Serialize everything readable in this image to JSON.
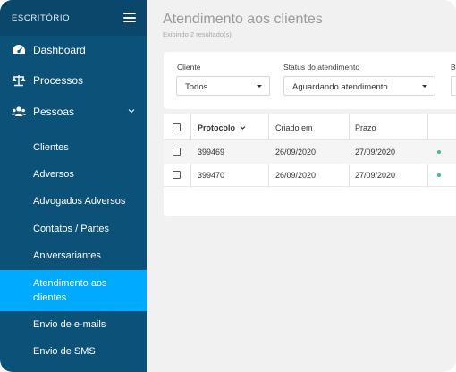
{
  "sidebar": {
    "brand": "ESCRITÓRIO",
    "menu_icon": "hamburger-menu-icon",
    "items": [
      {
        "label": "Dashboard",
        "icon": "speedometer-icon"
      },
      {
        "label": "Processos",
        "icon": "scales-icon"
      },
      {
        "label": "Pessoas",
        "icon": "users-icon",
        "expanded": true
      }
    ],
    "sub_items": [
      {
        "label": "Clientes"
      },
      {
        "label": "Adversos"
      },
      {
        "label": "Advogados Adversos"
      },
      {
        "label": "Contatos / Partes"
      },
      {
        "label": "Aniversariantes"
      },
      {
        "label_line1": "Atendimento aos",
        "label_line2": "clientes",
        "active": true
      },
      {
        "label": "Envio de e-mails"
      },
      {
        "label": "Envio de SMS"
      }
    ],
    "colors": {
      "bg": "#0c5178",
      "active": "#00aaff"
    }
  },
  "main": {
    "title": "Atendimento aos clientes",
    "subtitle": "Exibindo 2 resultado(s)",
    "filters": [
      {
        "label": "Cliente",
        "value": "Todos"
      },
      {
        "label": "Status do atendimento",
        "value": "Aguardando atendimento"
      },
      {
        "label": "B"
      }
    ],
    "table": {
      "columns": [
        "Protocolo",
        "Criado em",
        "Prazo"
      ],
      "sort_icon": "chevron-down-icon",
      "rows": [
        {
          "protocolo": "399469",
          "criado_em": "26/09/2020",
          "prazo": "27/09/2020",
          "status_color": "#3cbf7f"
        },
        {
          "protocolo": "399470",
          "criado_em": "26/09/2020",
          "prazo": "27/09/2020",
          "status_color": "#3cbf7f"
        }
      ]
    }
  }
}
